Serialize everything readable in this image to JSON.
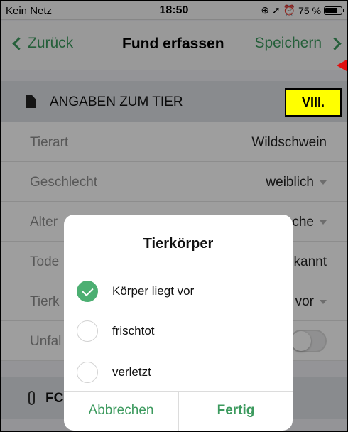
{
  "status_bar": {
    "carrier": "Kein Netz",
    "time": "18:50",
    "icons_text": "⊕ ➚ ⏰",
    "battery": "75 %"
  },
  "nav": {
    "back_label": "Zurück",
    "title": "Fund erfassen",
    "save_label": "Speichern"
  },
  "annotation_badge": "VIII.",
  "section1": {
    "title": "ANGABEN ZUM TIER",
    "rows": [
      {
        "label": "Tierart",
        "value": "Wildschwein",
        "dropdown": false
      },
      {
        "label": "Geschlecht",
        "value": "weiblich",
        "dropdown": true
      },
      {
        "label": "Alter",
        "value": "che",
        "dropdown": true
      },
      {
        "label": "Tode",
        "value": "kannt",
        "dropdown": false
      },
      {
        "label": "Tierk",
        "value": "vor",
        "dropdown": true
      },
      {
        "label": "Unfal",
        "value": "",
        "toggle": true
      }
    ]
  },
  "section2": {
    "title": "FC"
  },
  "modal": {
    "title": "Tierkörper",
    "options": [
      {
        "label": "Körper liegt vor",
        "checked": true
      },
      {
        "label": "frischtot",
        "checked": false
      },
      {
        "label": "verletzt",
        "checked": false
      }
    ],
    "cancel_label": "Abbrechen",
    "done_label": "Fertig"
  },
  "colors": {
    "accent": "#3c9a5e",
    "check": "#4caf72",
    "badge": "#ffff00",
    "arrow": "#e01010"
  }
}
